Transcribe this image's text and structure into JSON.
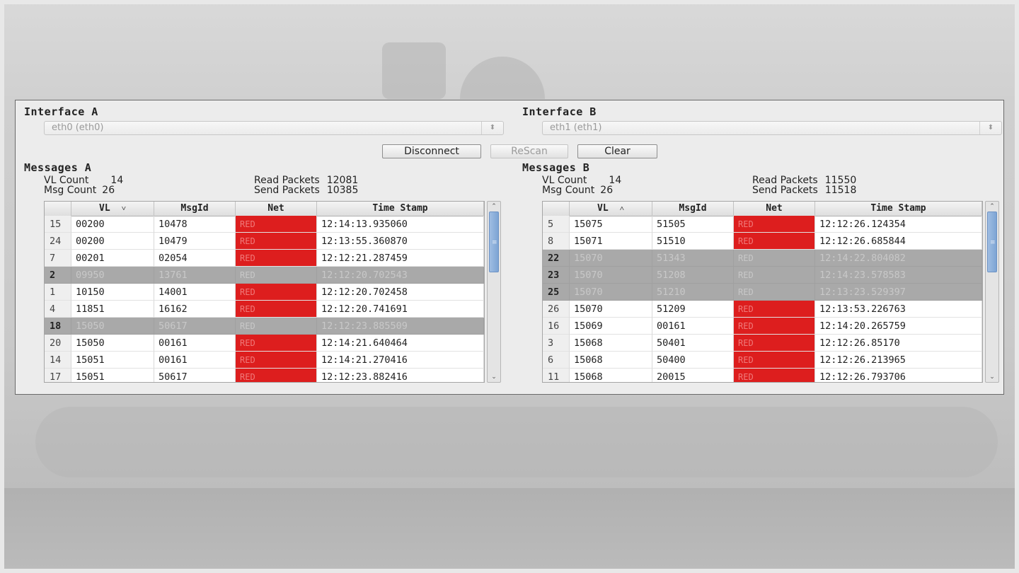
{
  "interface_a": {
    "title": "Interface A",
    "combo_value": "eth0 (eth0)"
  },
  "interface_b": {
    "title": "Interface B",
    "combo_value": "eth1 (eth1)"
  },
  "toolbar": {
    "disconnect_label": "Disconnect",
    "rescan_label": "ReScan",
    "clear_label": "Clear"
  },
  "messages_a": {
    "title": "Messages A",
    "vl_count_label": "VL Count",
    "vl_count": "14",
    "msg_count_label": "Msg Count",
    "msg_count": "26",
    "read_packets_label": "Read Packets",
    "read_packets": "12081",
    "send_packets_label": "Send Packets",
    "send_packets": "10385",
    "columns": [
      "VL",
      "MsgId",
      "Net",
      "Time Stamp"
    ],
    "sort_indicator": "˅",
    "rows": [
      {
        "idx": "15",
        "vl": "00200",
        "msgid": "10478",
        "net": "RED",
        "ts": "12:14:13.935060",
        "selected": false
      },
      {
        "idx": "24",
        "vl": "00200",
        "msgid": "10479",
        "net": "RED",
        "ts": "12:13:55.360870",
        "selected": false
      },
      {
        "idx": "7",
        "vl": "00201",
        "msgid": "02054",
        "net": "RED",
        "ts": "12:12:21.287459",
        "selected": false
      },
      {
        "idx": "2",
        "vl": "09950",
        "msgid": "13761",
        "net": "RED",
        "ts": "12:12:20.702543",
        "selected": true
      },
      {
        "idx": "1",
        "vl": "10150",
        "msgid": "14001",
        "net": "RED",
        "ts": "12:12:20.702458",
        "selected": false
      },
      {
        "idx": "4",
        "vl": "11851",
        "msgid": "16162",
        "net": "RED",
        "ts": "12:12:20.741691",
        "selected": false
      },
      {
        "idx": "18",
        "vl": "15050",
        "msgid": "50617",
        "net": "RED",
        "ts": "12:12:23.885509",
        "selected": true
      },
      {
        "idx": "20",
        "vl": "15050",
        "msgid": "00161",
        "net": "RED",
        "ts": "12:14:21.640464",
        "selected": false
      },
      {
        "idx": "14",
        "vl": "15051",
        "msgid": "00161",
        "net": "RED",
        "ts": "12:14:21.270416",
        "selected": false
      },
      {
        "idx": "17",
        "vl": "15051",
        "msgid": "50617",
        "net": "RED",
        "ts": "12:12:23.882416",
        "selected": false
      }
    ]
  },
  "messages_b": {
    "title": "Messages B",
    "vl_count_label": "VL Count",
    "vl_count": "14",
    "msg_count_label": "Msg Count",
    "msg_count": "26",
    "read_packets_label": "Read Packets",
    "read_packets": "11550",
    "send_packets_label": "Send Packets",
    "send_packets": "11518",
    "columns": [
      "VL",
      "MsgId",
      "Net",
      "Time Stamp"
    ],
    "sort_indicator": "˄",
    "rows": [
      {
        "idx": "5",
        "vl": "15075",
        "msgid": "51505",
        "net": "RED",
        "ts": "12:12:26.124354",
        "selected": false
      },
      {
        "idx": "8",
        "vl": "15071",
        "msgid": "51510",
        "net": "RED",
        "ts": "12:12:26.685844",
        "selected": false
      },
      {
        "idx": "22",
        "vl": "15070",
        "msgid": "51343",
        "net": "RED",
        "ts": "12:14:22.804082",
        "selected": true
      },
      {
        "idx": "23",
        "vl": "15070",
        "msgid": "51208",
        "net": "RED",
        "ts": "12:14:23.578583",
        "selected": true
      },
      {
        "idx": "25",
        "vl": "15070",
        "msgid": "51210",
        "net": "RED",
        "ts": "12:13:23.529397",
        "selected": true
      },
      {
        "idx": "26",
        "vl": "15070",
        "msgid": "51209",
        "net": "RED",
        "ts": "12:13:53.226763",
        "selected": false
      },
      {
        "idx": "16",
        "vl": "15069",
        "msgid": "00161",
        "net": "RED",
        "ts": "12:14:20.265759",
        "selected": false
      },
      {
        "idx": "3",
        "vl": "15068",
        "msgid": "50401",
        "net": "RED",
        "ts": "12:12:26.85170",
        "selected": false
      },
      {
        "idx": "6",
        "vl": "15068",
        "msgid": "50400",
        "net": "RED",
        "ts": "12:12:26.213965",
        "selected": false
      },
      {
        "idx": "11",
        "vl": "15068",
        "msgid": "20015",
        "net": "RED",
        "ts": "12:12:26.793706",
        "selected": false
      }
    ]
  },
  "colors": {
    "net_red": "#dd1e1e",
    "selected_row": "#a9a9a9",
    "scroll_thumb": "#7da4d4"
  },
  "icons": {
    "combo_arrow": "updown-chevron-icon",
    "scroll_up": "chevron-up-icon",
    "scroll_down": "chevron-down-icon"
  }
}
